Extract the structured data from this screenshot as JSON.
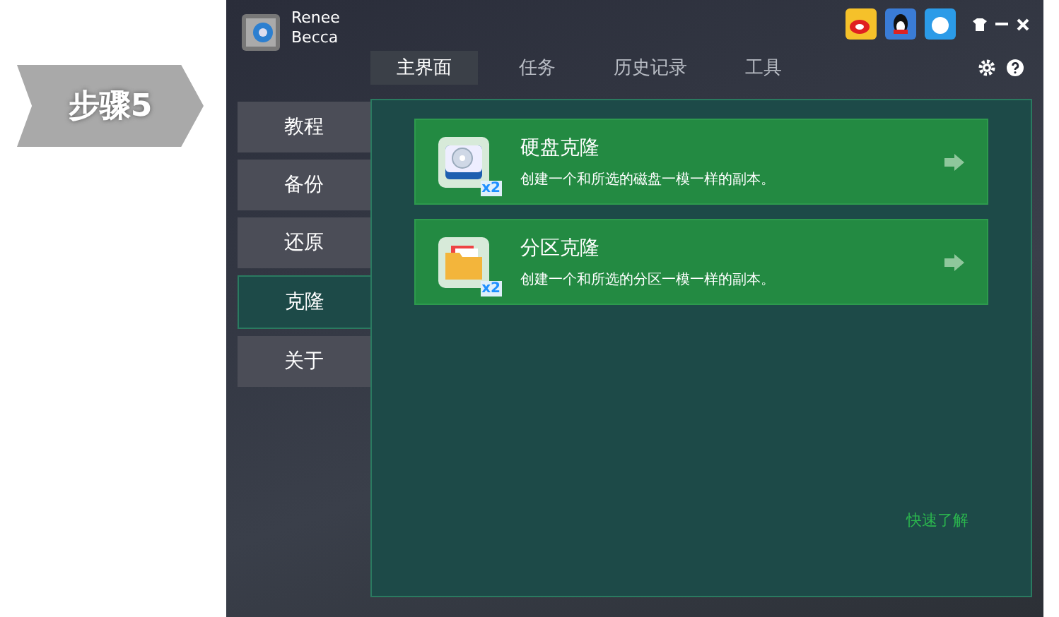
{
  "step_badge": "步骤5",
  "app": {
    "brand_lines": [
      "Renee",
      "Becca"
    ],
    "tabs": [
      {
        "label": "主界面",
        "selected": true
      },
      {
        "label": "任务",
        "selected": false
      },
      {
        "label": "历史记录",
        "selected": false
      },
      {
        "label": "工具",
        "selected": false
      }
    ],
    "sidebar": [
      {
        "label": "教程",
        "selected": false
      },
      {
        "label": "备份",
        "selected": false
      },
      {
        "label": "还原",
        "selected": false
      },
      {
        "label": "克隆",
        "selected": true
      },
      {
        "label": "关于",
        "selected": false
      }
    ],
    "cards": [
      {
        "kind": "disk",
        "title": "硬盘克隆",
        "description": "创建一个和所选的磁盘一模一样的副本。",
        "badge": "x2"
      },
      {
        "kind": "partition",
        "title": "分区克隆",
        "description": "创建一个和所选的分区一模一样的副本。",
        "badge": "x2"
      }
    ],
    "link": "快速了解"
  }
}
